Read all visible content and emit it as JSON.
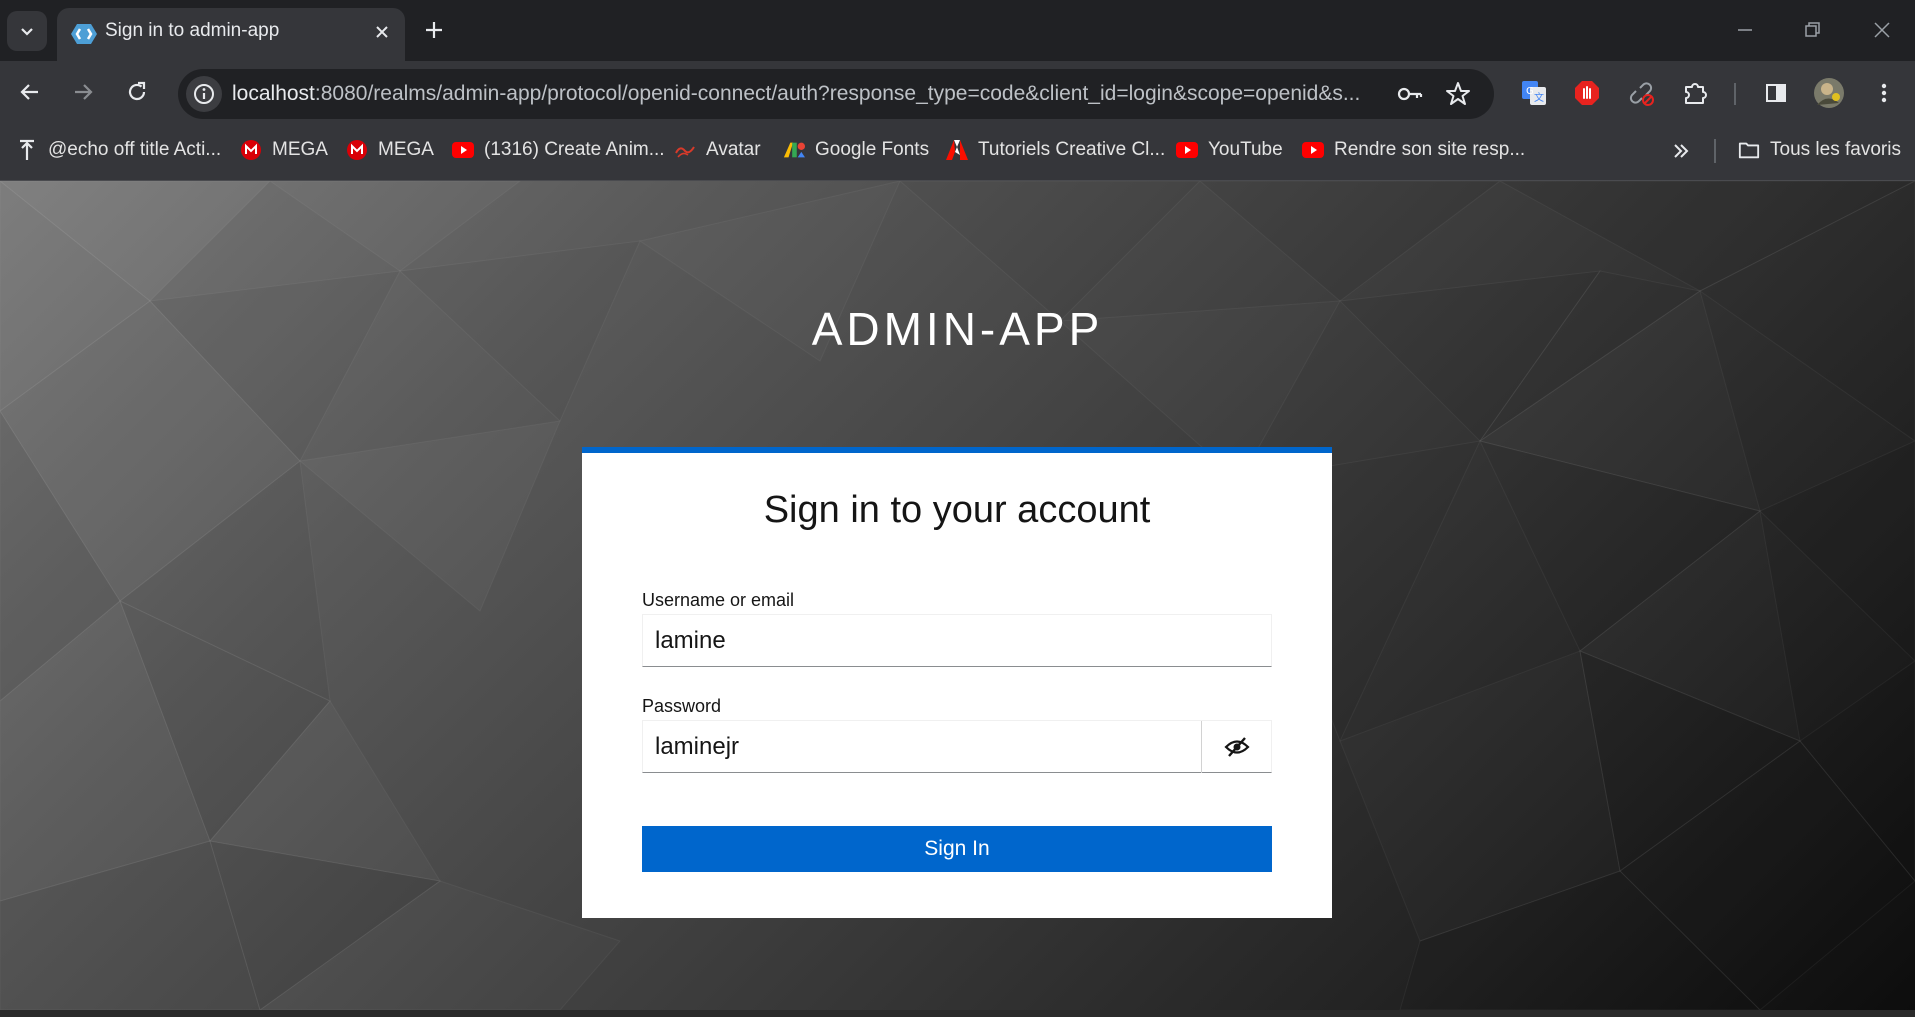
{
  "browser": {
    "tab": {
      "title": "Sign in to admin-app"
    },
    "address": {
      "host": "localhost",
      "path": ":8080/realms/admin-app/protocol/openid-connect/auth?response_type=code&client_id=login&scope=openid&s..."
    },
    "bookmarks": [
      {
        "label": "@echo off title Acti...",
        "icon": "pin-icon"
      },
      {
        "label": "MEGA",
        "icon": "mega-icon"
      },
      {
        "label": "MEGA",
        "icon": "mega-icon"
      },
      {
        "label": "(1316) Create Anim...",
        "icon": "youtube-icon"
      },
      {
        "label": "Avatar",
        "icon": "avatar-icon"
      },
      {
        "label": "Google Fonts",
        "icon": "google-fonts-icon"
      },
      {
        "label": "Tutoriels Creative Cl...",
        "icon": "adobe-icon"
      },
      {
        "label": "YouTube",
        "icon": "youtube-icon"
      },
      {
        "label": "Rendre son site resp...",
        "icon": "youtube-icon"
      }
    ],
    "all_bookmarks_label": "Tous les favoris"
  },
  "login": {
    "realm_title": "ADMIN-APP",
    "heading": "Sign in to your account",
    "username_label": "Username or email",
    "username_value": "lamine",
    "password_label": "Password",
    "password_value": "laminejr",
    "submit_label": "Sign In"
  },
  "colors": {
    "accent": "#0066cc",
    "card": "#ffffff",
    "browser_chrome": "#35363a"
  }
}
